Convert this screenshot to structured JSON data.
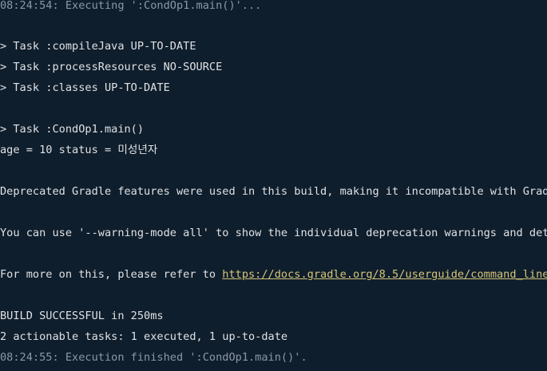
{
  "console": {
    "exec_start": "08:24:54: Executing ':CondOp1.main()'...",
    "task_compile": "> Task :compileJava UP-TO-DATE",
    "task_resources": "> Task :processResources NO-SOURCE",
    "task_classes": "> Task :classes UP-TO-DATE",
    "task_main": "> Task :CondOp1.main()",
    "program_output": "age = 10 status = 미성년자",
    "deprecated_notice": "Deprecated Gradle features were used in this build, making it incompatible with Grad",
    "warning_mode_hint": "You can use '--warning-mode all' to show the individual deprecation warnings and det",
    "refer_prefix": "For more on this, please refer to ",
    "refer_link": "https://docs.gradle.org/8.5/userguide/command_line",
    "build_result": "BUILD SUCCESSFUL in 250ms",
    "tasks_summary": "2 actionable tasks: 1 executed, 1 up-to-date",
    "exec_end": "08:24:55: Execution finished ':CondOp1.main()'."
  },
  "colors": {
    "background": "#0f1e2c",
    "text": "#dfe1e5",
    "meta_text": "#8a97a8",
    "link": "#d6c57a"
  }
}
